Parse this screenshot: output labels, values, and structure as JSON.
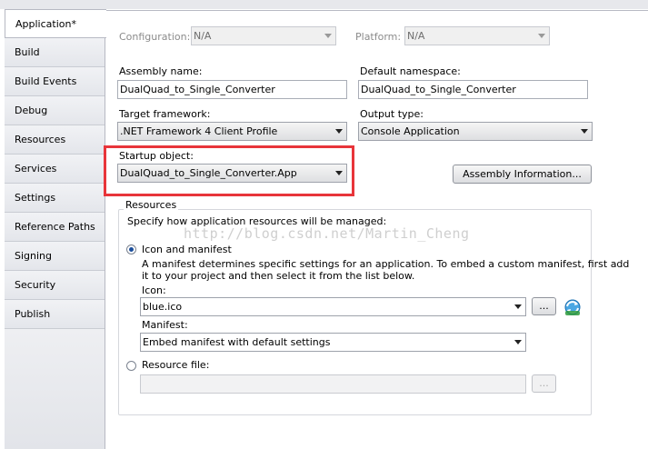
{
  "sidebar": {
    "tabs": [
      {
        "label": "Application*",
        "active": true
      },
      {
        "label": "Build"
      },
      {
        "label": "Build Events"
      },
      {
        "label": "Debug"
      },
      {
        "label": "Resources"
      },
      {
        "label": "Services"
      },
      {
        "label": "Settings"
      },
      {
        "label": "Reference Paths"
      },
      {
        "label": "Signing"
      },
      {
        "label": "Security"
      },
      {
        "label": "Publish"
      }
    ]
  },
  "config": {
    "configuration_label": "Configuration:",
    "configuration_value": "N/A",
    "platform_label": "Platform:",
    "platform_value": "N/A"
  },
  "assembly": {
    "name_label": "Assembly name:",
    "name_value": "DualQuad_to_Single_Converter",
    "namespace_label": "Default namespace:",
    "namespace_value": "DualQuad_to_Single_Converter"
  },
  "framework": {
    "label": "Target framework:",
    "value": ".NET Framework 4 Client Profile"
  },
  "output": {
    "label": "Output type:",
    "value": "Console Application"
  },
  "startup": {
    "label": "Startup object:",
    "value": "DualQuad_to_Single_Converter.App"
  },
  "assembly_info_button": "Assembly Information...",
  "resources": {
    "legend": "Resources",
    "description": "Specify how application resources will be managed:",
    "icon_manifest_option": "Icon and manifest",
    "icon_manifest_desc_line1": "A manifest determines specific settings for an application. To embed a custom manifest, first add",
    "icon_manifest_desc_line2": "it to your project and then select it from the list below.",
    "icon_label": "Icon:",
    "icon_value": "blue.ico",
    "browse_label": "...",
    "manifest_label": "Manifest:",
    "manifest_value": "Embed manifest with default settings",
    "resource_file_option": "Resource file:",
    "resource_browse_label": "...",
    "selected_option": "icon_and_manifest"
  },
  "watermark": "http://blog.csdn.net/Martin_Cheng",
  "colors": {
    "highlight_border": "#e8353a",
    "radio_dot": "#1b4e9c"
  }
}
